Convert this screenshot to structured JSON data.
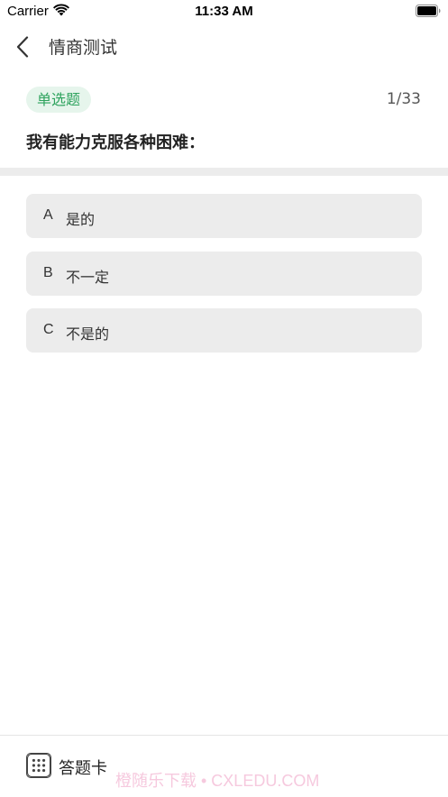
{
  "status_bar": {
    "carrier": "Carrier",
    "time": "11:33 AM"
  },
  "nav": {
    "title": "情商测试"
  },
  "question": {
    "type_label": "单选题",
    "progress": "1/33",
    "text": "我有能力克服各种困难："
  },
  "options": [
    {
      "letter": "A",
      "text": "是的"
    },
    {
      "letter": "B",
      "text": "不一定"
    },
    {
      "letter": "C",
      "text": "不是的"
    }
  ],
  "bottom_bar": {
    "answer_card_label": "答题卡",
    "watermark": "橙随乐下载 • CXLEDU.COM"
  },
  "colors": {
    "accent_green": "#2ea35e",
    "tag_background": "#e6f5ec",
    "option_background": "#ececec"
  },
  "icons": {
    "wifi": "wifi-icon",
    "battery": "battery-icon",
    "back": "chevron-left-icon",
    "answer_card": "grid-icon"
  }
}
